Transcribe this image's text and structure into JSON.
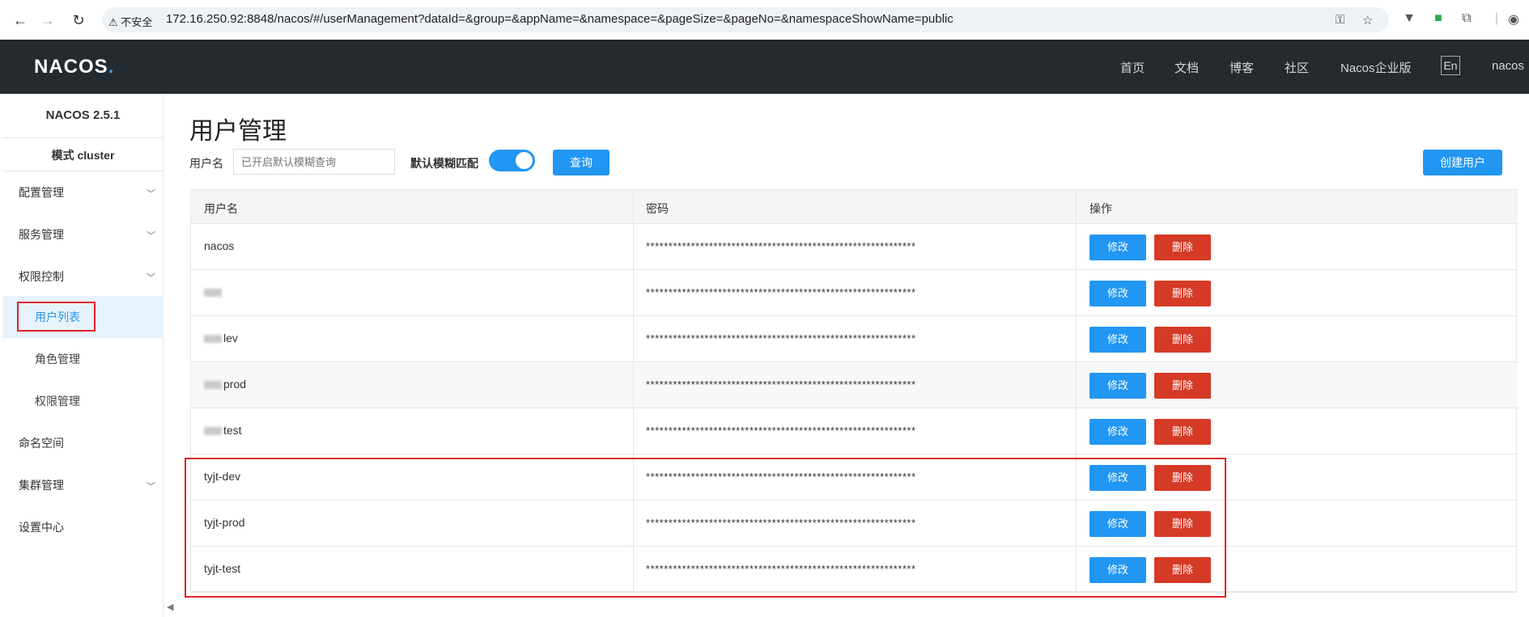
{
  "browser": {
    "insecure_label": "不安全",
    "url": "172.16.250.92:8848/nacos/#/userManagement?dataId=&group=&appName=&namespace=&pageSize=&pageNo=&namespaceShowName=public"
  },
  "topbar": {
    "logo_main": "NACOS",
    "logo_dot": ".",
    "nav": [
      "首页",
      "文档",
      "博客",
      "社区",
      "Nacos企业版"
    ],
    "lang": "En",
    "user": "nacos"
  },
  "sidebar": {
    "version": "NACOS 2.5.1",
    "mode": "模式 cluster",
    "config": "配置管理",
    "service": "服务管理",
    "auth": "权限控制",
    "users": "用户列表",
    "roles": "角色管理",
    "perms": "权限管理",
    "namespace": "命名空间",
    "cluster": "集群管理",
    "settings": "设置中心"
  },
  "main": {
    "title": "用户管理",
    "username_label": "用户名",
    "search_placeholder": "已开启默认模糊查询",
    "fuzzy_label": "默认模糊匹配",
    "query_btn": "查询",
    "create_btn": "创建用户"
  },
  "table": {
    "headers": [
      "用户名",
      "密码",
      "操作"
    ],
    "edit": "修改",
    "delete": "删除",
    "rows": [
      {
        "user": "nacos",
        "pwd": "************************************************************"
      },
      {
        "user": "",
        "pwd": "************************************************************"
      },
      {
        "user": "lev",
        "pwd": "************************************************************"
      },
      {
        "user": "prod",
        "pwd": "************************************************************"
      },
      {
        "user": "test",
        "pwd": "************************************************************"
      },
      {
        "user": "tyjt-dev",
        "pwd": "************************************************************"
      },
      {
        "user": "tyjt-prod",
        "pwd": "************************************************************"
      },
      {
        "user": "tyjt-test",
        "pwd": "************************************************************"
      }
    ]
  }
}
